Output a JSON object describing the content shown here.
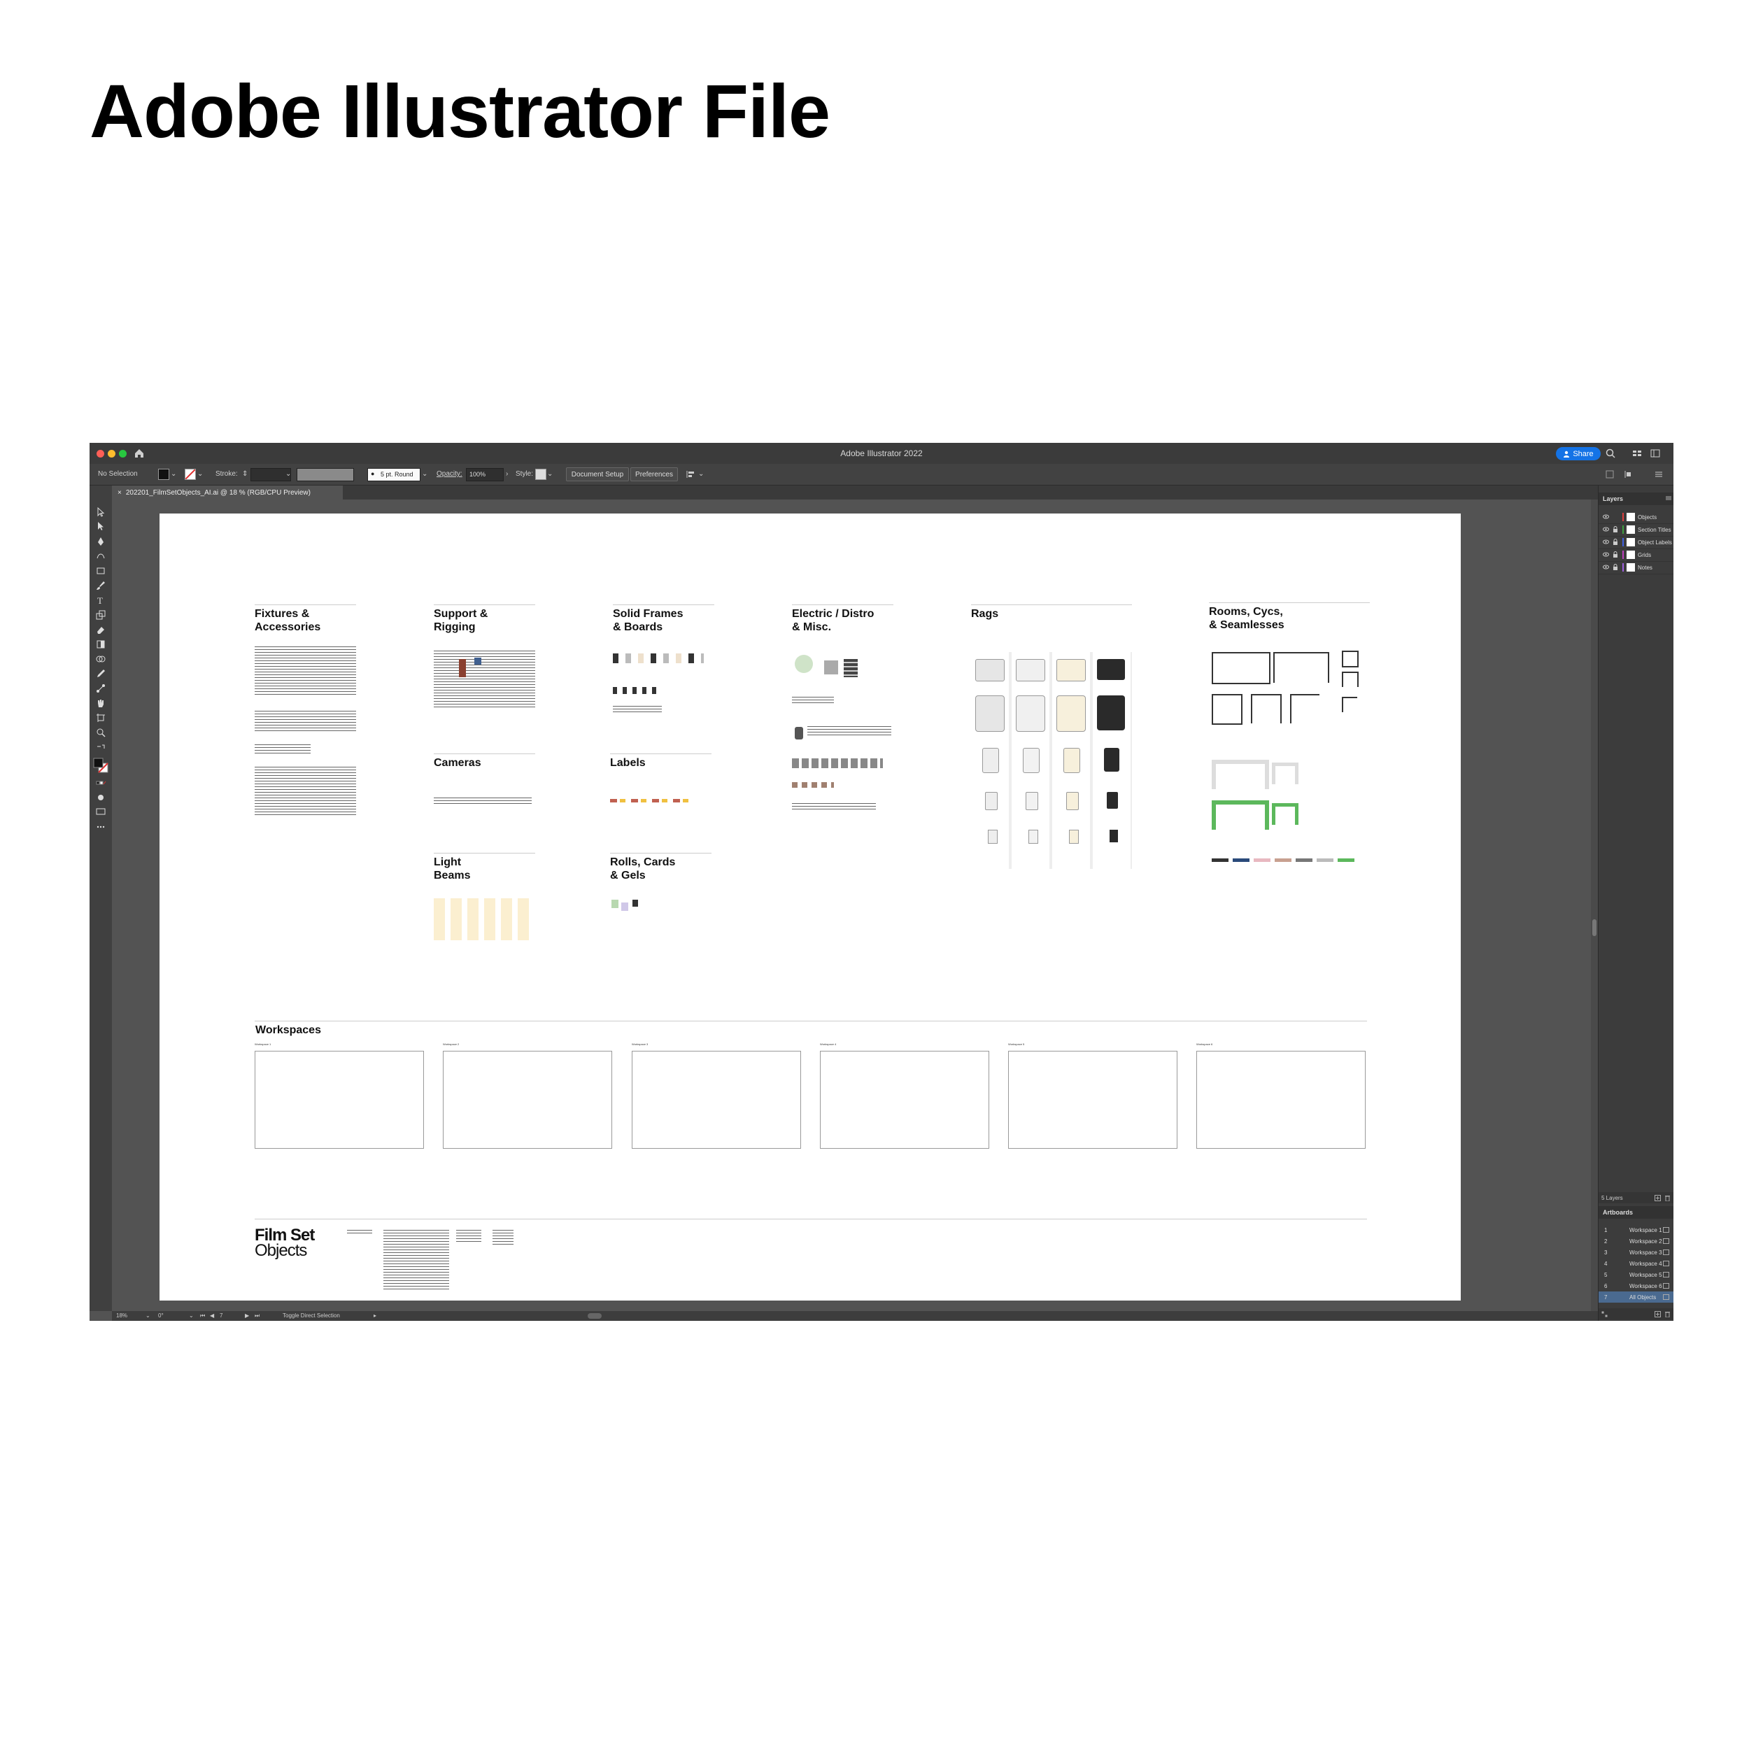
{
  "heading": "Adobe Illustrator File",
  "app": {
    "title": "Adobe Illustrator 2022",
    "share_label": "Share"
  },
  "control_bar": {
    "selection": "No Selection",
    "stroke_label": "Stroke:",
    "brush": "5 pt. Round",
    "opacity_label": "Opacity:",
    "opacity_value": "100%",
    "style_label": "Style:",
    "document_setup": "Document Setup",
    "preferences": "Preferences"
  },
  "document_tab": {
    "close": "×",
    "title": "202201_FilmSetObjects_AI.ai @ 18 % (RGB/CPU Preview)"
  },
  "artboard": {
    "sections": [
      {
        "title": "Fixtures &\nAccessories"
      },
      {
        "title": "Support &\nRigging"
      },
      {
        "title": "Solid Frames\n& Boards"
      },
      {
        "title": "Electric / Distro\n& Misc."
      },
      {
        "title": "Rags"
      },
      {
        "title": "Rooms, Cycs,\n& Seamlesses"
      },
      {
        "title": "Cameras"
      },
      {
        "title": "Labels"
      },
      {
        "title": "Light\nBeams"
      },
      {
        "title": "Rolls, Cards\n& Gels"
      }
    ],
    "workspaces_title": "Workspaces",
    "workspace_labels": [
      "Workspace 1",
      "Workspace 2",
      "Workspace 3",
      "Workspace 4",
      "Workspace 5",
      "Workspace 6"
    ],
    "logo_line1": "Film Set",
    "logo_line2": "Objects"
  },
  "layers_panel": {
    "tab": "Layers",
    "layers": [
      {
        "name": "Objects",
        "color": "#e04040"
      },
      {
        "name": "Section Titles",
        "color": "#40a040"
      },
      {
        "name": "Object Labels",
        "color": "#4060e0"
      },
      {
        "name": "Grids",
        "color": "#c040c0"
      },
      {
        "name": "Notes",
        "color": "#a060e0"
      }
    ],
    "count": "5 Layers"
  },
  "artboards_panel": {
    "tab": "Artboards",
    "items": [
      {
        "num": "1",
        "name": "Workspace 1"
      },
      {
        "num": "2",
        "name": "Workspace 2"
      },
      {
        "num": "3",
        "name": "Workspace 3"
      },
      {
        "num": "4",
        "name": "Workspace 4"
      },
      {
        "num": "5",
        "name": "Workspace 5"
      },
      {
        "num": "6",
        "name": "Workspace 6"
      },
      {
        "num": "7",
        "name": "All Objects"
      }
    ],
    "selected_index": 6
  },
  "status_bar": {
    "zoom": "18%",
    "rotation": "0°",
    "artboard_num": "7",
    "tool_hint": "Toggle Direct Selection"
  },
  "colors": {
    "accent_blue": "#1473e6",
    "panel_bg": "#3c3c3c",
    "canvas_bg": "#535353",
    "selected_row": "#4a6a90"
  }
}
